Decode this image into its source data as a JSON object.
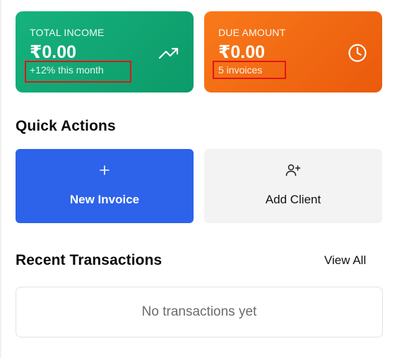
{
  "cards": {
    "income": {
      "label": "TOTAL INCOME",
      "amount": "₹0.00",
      "sub": "+12% this month",
      "icon": "trending-up-icon",
      "color": "#10a874"
    },
    "due": {
      "label": "DUE AMOUNT",
      "amount": "₹0.00",
      "sub": "5 invoices",
      "icon": "clock-icon",
      "color": "#f36b14"
    }
  },
  "quick_actions": {
    "title": "Quick Actions",
    "new_invoice": {
      "label": "New Invoice",
      "icon": "plus-icon",
      "color": "#2d63ea"
    },
    "add_client": {
      "label": "Add Client",
      "icon": "user-plus-icon",
      "color": "#f3f3f3"
    }
  },
  "recent_transactions": {
    "title": "Recent Transactions",
    "view_all": "View All",
    "empty_text": "No transactions yet"
  },
  "highlight_color": "#e01616"
}
